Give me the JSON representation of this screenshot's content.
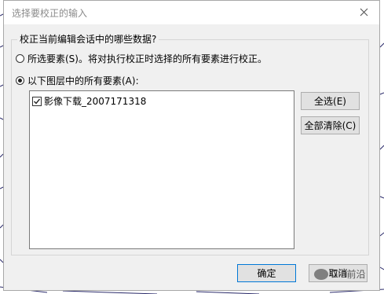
{
  "dialog": {
    "title": "选择要校正的输入",
    "close_label": "×"
  },
  "group": {
    "legend": "校正当前编辑会话中的哪些数据?"
  },
  "options": {
    "selected_features": "所选要素(S)。将对执行校正时选择的所有要素进行校正。",
    "all_features_in_layers": "以下图层中的所有要素(A):"
  },
  "layers": [
    {
      "name": "影像下载_2007171318",
      "checked": true
    }
  ],
  "buttons": {
    "select_all": "全选(E)",
    "clear_all": "全部清除(C)",
    "ok": "确定",
    "cancel": "取消"
  },
  "watermark": "GIS前沿"
}
